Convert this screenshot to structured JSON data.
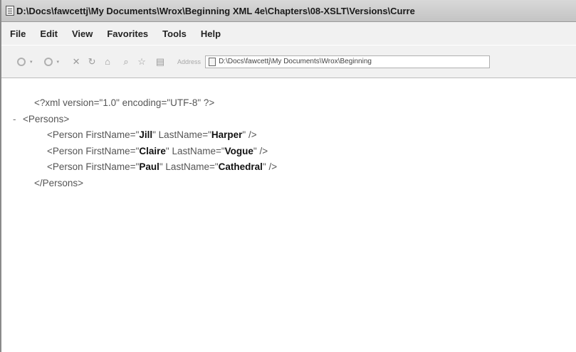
{
  "window": {
    "title": "D:\\Docs\\fawcettj\\My Documents\\Wrox\\Beginning XML 4e\\Chapters\\08-XSLT\\Versions\\Curre"
  },
  "menu": {
    "items": [
      "File",
      "Edit",
      "View",
      "Favorites",
      "Tools",
      "Help"
    ]
  },
  "toolbar": {
    "address_label": "Address",
    "address_value": "D:\\Docs\\fawcettj\\My Documents\\Wrox\\Beginning"
  },
  "xml": {
    "declaration": "<?xml version=\"1.0\" encoding=\"UTF-8\" ?>",
    "collapse_marker": "-",
    "root_open": "<Persons>",
    "root_close": "</Persons>",
    "person_open": "<Person ",
    "attr_first": "FirstName=",
    "attr_last": " LastName=",
    "quote": "\"",
    "self_close": " />",
    "persons": [
      {
        "first": "Jill",
        "last": "Harper"
      },
      {
        "first": "Claire",
        "last": "Vogue"
      },
      {
        "first": "Paul",
        "last": "Cathedral"
      }
    ]
  },
  "icons": [
    "document-icon",
    "back-icon",
    "forward-icon",
    "stop-icon",
    "refresh-icon",
    "home-icon",
    "search-icon",
    "favorites-icon",
    "media-icon",
    "page-icon"
  ]
}
